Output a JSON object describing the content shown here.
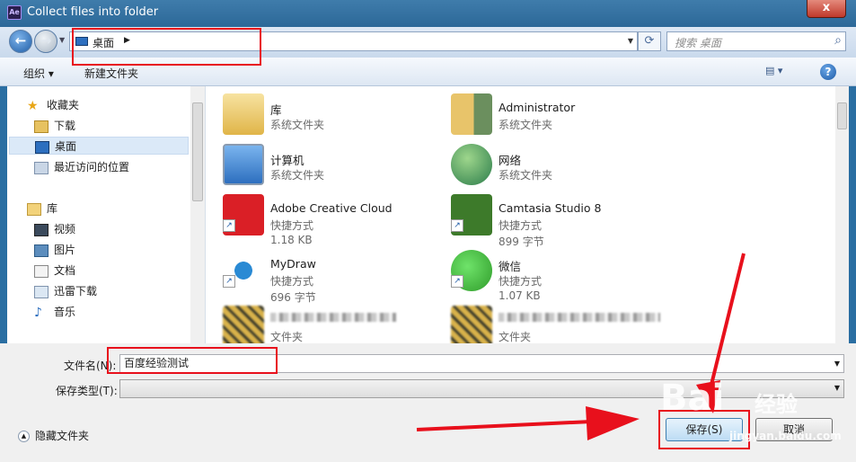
{
  "window": {
    "title": "Collect files into folder",
    "app_icon_text": "Ae",
    "close_label": "x"
  },
  "nav": {
    "address": "桌面",
    "search_placeholder": "搜索 桌面"
  },
  "toolbar": {
    "organize": "组织 ▾",
    "new_folder": "新建文件夹"
  },
  "sidebar": {
    "favorites": "收藏夹",
    "downloads": "下载",
    "desktop": "桌面",
    "recent": "最近访问的位置",
    "libraries": "库",
    "videos": "视频",
    "pictures": "图片",
    "documents": "文档",
    "xunlei": "迅雷下载",
    "music": "音乐"
  },
  "files": [
    {
      "name": "库",
      "sub1": "系统文件夹",
      "sub2": "",
      "icon": "library-icon",
      "color": "#f2d27a"
    },
    {
      "name": "Administrator",
      "sub1": "系统文件夹",
      "sub2": "",
      "icon": "user-folder-icon",
      "color": "#e8c46a"
    },
    {
      "name": "计算机",
      "sub1": "系统文件夹",
      "sub2": "",
      "icon": "computer-icon",
      "color": "#4d8fd6"
    },
    {
      "name": "网络",
      "sub1": "系统文件夹",
      "sub2": "",
      "icon": "network-icon",
      "color": "#3a9a5c"
    },
    {
      "name": "Adobe Creative Cloud",
      "sub1": "快捷方式",
      "sub2": "1.18 KB",
      "icon": "adobe-cc-icon",
      "color": "#da1f26"
    },
    {
      "name": "Camtasia Studio 8",
      "sub1": "快捷方式",
      "sub2": "899 字节",
      "icon": "camtasia-icon",
      "color": "#3d7a2a"
    },
    {
      "name": "MyDraw",
      "sub1": "快捷方式",
      "sub2": "696 字节",
      "icon": "mydraw-icon",
      "color": "#2a8ad4"
    },
    {
      "name": "微信",
      "sub1": "快捷方式",
      "sub2": "1.07 KB",
      "icon": "wechat-icon",
      "color": "#3fbf3a"
    },
    {
      "name": "",
      "sub1": "文件夹",
      "sub2": "",
      "icon": "folder-icon",
      "color": "#d9b24a"
    },
    {
      "name": "",
      "sub1": "文件夹",
      "sub2": "",
      "icon": "folder-icon",
      "color": "#d9b24a"
    }
  ],
  "form": {
    "filename_label": "文件名(N):",
    "filename_value": "百度经验测试",
    "filetype_label": "保存类型(T):",
    "filetype_value": ""
  },
  "buttons": {
    "hide_folders": "隐藏文件夹",
    "save": "保存(S)",
    "cancel": "取消"
  },
  "watermark": {
    "text1": "Bai",
    "text2": "经验",
    "url": "jingyan.baidu.com"
  }
}
